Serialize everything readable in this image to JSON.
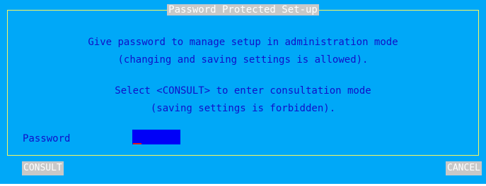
{
  "dialog": {
    "title": "Password Protected Set-up",
    "message_lines": [
      "Give password to manage setup in administration mode",
      "(changing and saving settings is allowed).",
      "Select <CONSULT> to enter consultation mode",
      "(saving settings is forbidden)."
    ],
    "password_label": "Password",
    "password_value": "",
    "buttons": {
      "consult": "CONSULT",
      "cancel": "CANCEL"
    }
  },
  "colors": {
    "background": "#00a8f8",
    "frame": "#f8f860",
    "text": "#1010c8",
    "input_bg": "#0000f8",
    "button_bg": "#c8c8c8",
    "caret": "#e01818"
  }
}
